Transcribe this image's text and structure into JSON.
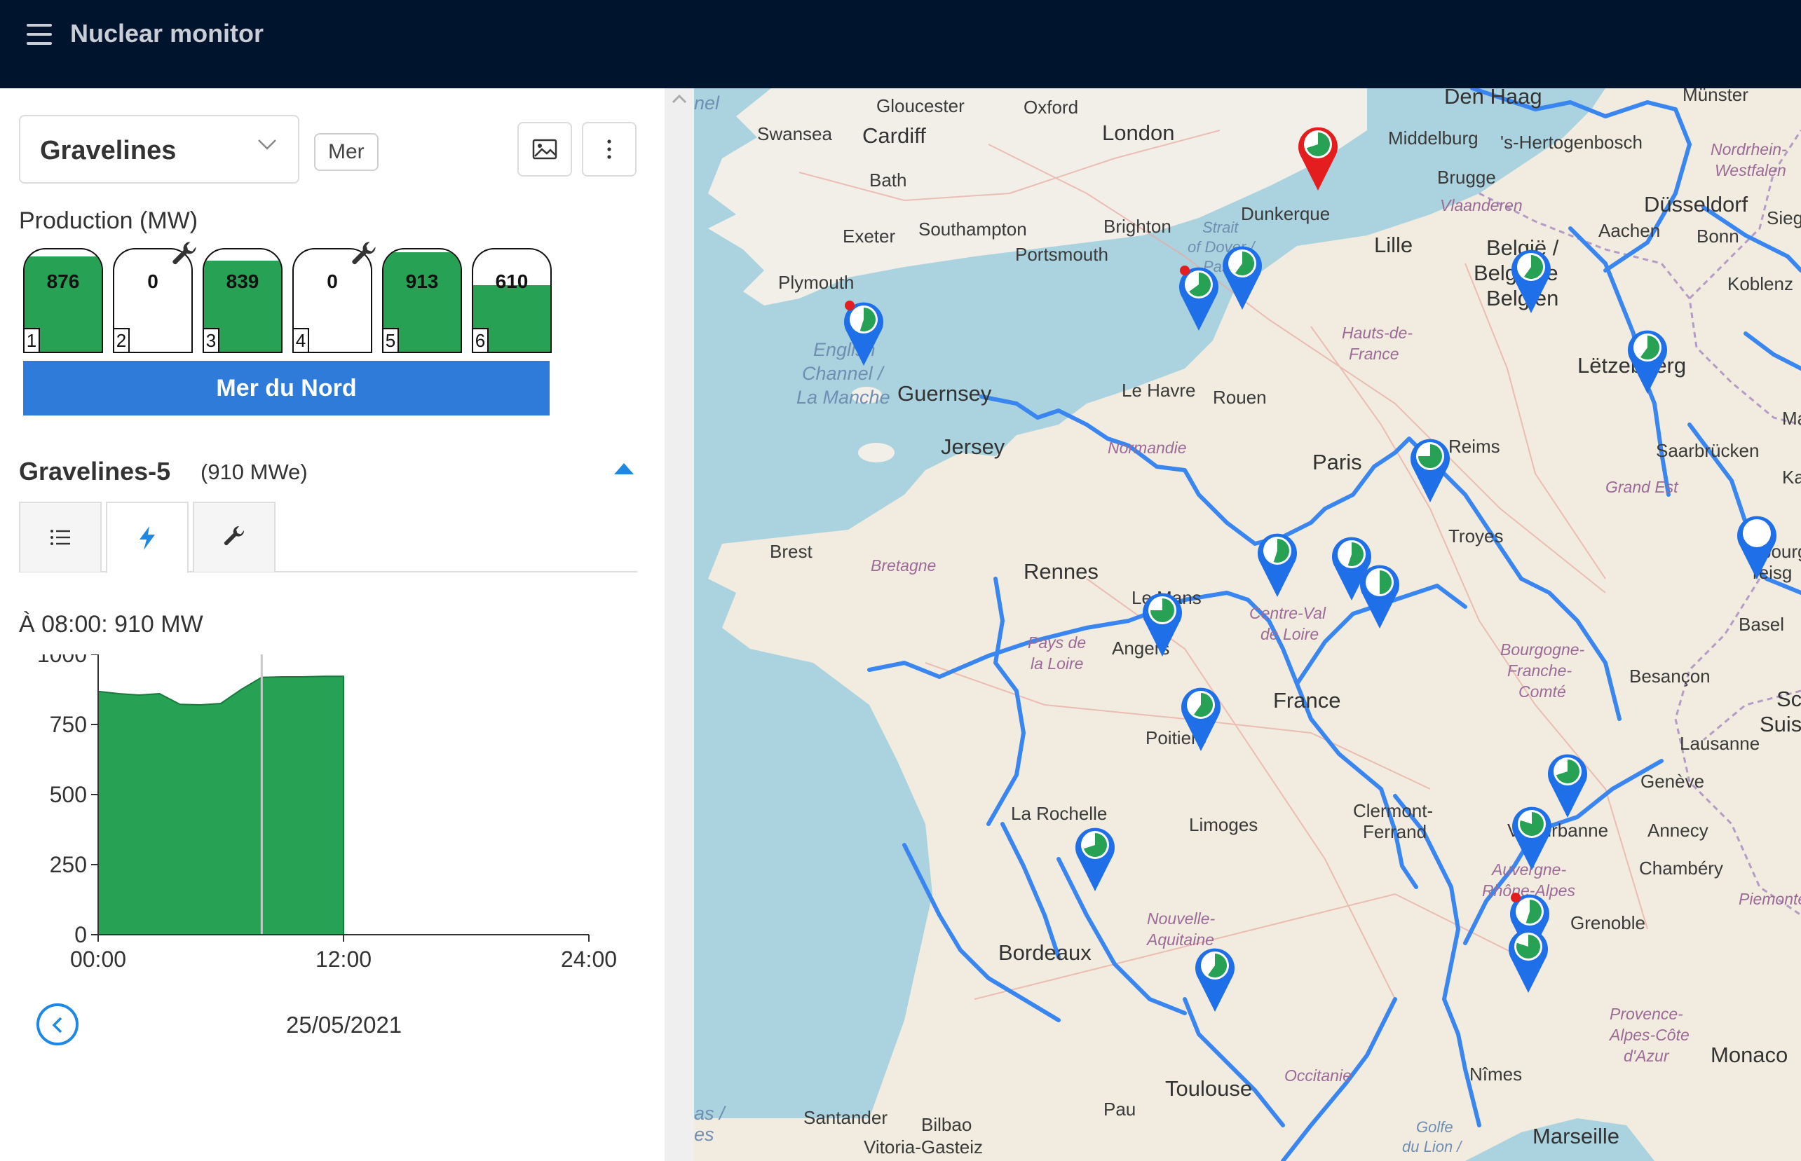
{
  "app": {
    "title": "Nuclear monitor"
  },
  "site_selector": {
    "selected": "Gravelines"
  },
  "tag": "Mer",
  "production": {
    "label": "Production (MW)",
    "reactors": [
      {
        "num": "1",
        "value": "876",
        "fill": 0.93,
        "maintenance": false
      },
      {
        "num": "2",
        "value": "0",
        "fill": 0,
        "maintenance": true
      },
      {
        "num": "3",
        "value": "839",
        "fill": 0.89,
        "maintenance": false
      },
      {
        "num": "4",
        "value": "0",
        "fill": 0,
        "maintenance": true
      },
      {
        "num": "5",
        "value": "913",
        "fill": 0.97,
        "maintenance": false
      },
      {
        "num": "6",
        "value": "610",
        "fill": 0.65,
        "maintenance": false
      }
    ],
    "cooling_source": "Mer du Nord"
  },
  "unit": {
    "name": "Gravelines-5",
    "capacity": "(910 MWe)"
  },
  "at_time": "À 08:00: 910 MW",
  "date": "25/05/2021",
  "chart_data": {
    "type": "area",
    "x": [
      0,
      1,
      2,
      3,
      4,
      5,
      6,
      7,
      8,
      9,
      10,
      11,
      12
    ],
    "x_units": "hours",
    "values": [
      868,
      860,
      855,
      860,
      822,
      820,
      825,
      875,
      918,
      920,
      920,
      922,
      922
    ],
    "xlim": [
      0,
      24
    ],
    "ylim": [
      0,
      1000
    ],
    "x_ticks": [
      "00:00",
      "12:00",
      "24:00"
    ],
    "y_ticks": [
      "0",
      "250",
      "500",
      "750",
      "1000"
    ],
    "cursor_x": 8,
    "color": "#27a254"
  },
  "map": {
    "labels": {
      "den_haag": "Den Haag",
      "munster": "Münster",
      "gloucester": "Gloucester",
      "oxford": "Oxford",
      "swansea": "Swansea",
      "cardiff": "Cardiff",
      "london": "London",
      "middelburg": "Middelburg",
      "hertogenbosch": "'s-Hertogenbosch",
      "nordrhein": "Nordrhein-",
      "westfalen": "Westfalen",
      "bath": "Bath",
      "brugge": "Brugge",
      "dusseldorf": "Düsseldorf",
      "siege": "Siege",
      "exeter": "Exeter",
      "southampton": "Southampton",
      "brighton": "Brighton",
      "dunkerque": "Dunkerque",
      "vlaanderen": "Vlaanderen",
      "aachen": "Aachen",
      "bonn": "Bonn",
      "portsmouth": "Portsmouth",
      "strait": "Strait",
      "dover": "of Dover /",
      "pas_de": "Pas de",
      "lille": "Lille",
      "belgie": "België /",
      "belgique": "Belgique",
      "belgien": "Belgien",
      "plymouth": "Plymouth",
      "koblenz": "Koblenz",
      "english": "English",
      "channel": "Channel /",
      "la_manche": "La Manche",
      "guernsey": "Guernsey",
      "hauts": "Hauts-de-",
      "france_region": "France",
      "letzebuerg": "Lëtzebuerg",
      "le_havre": "Le Havre",
      "rouen": "Rouen",
      "jersey": "Jersey",
      "normandie": "Normandie",
      "reims": "Reims",
      "saarbrucken": "Saarbrücken",
      "ma": "Ma",
      "paris": "Paris",
      "grand_est": "Grand Est",
      "ka": "Ka",
      "brest": "Brest",
      "troyes": "Troyes",
      "bretagne": "Bretagne",
      "rennes": "Rennes",
      "le_mans": "Le Mans",
      "centre": "Centre-Val",
      "de_loire": "de Loire",
      "pays": "Pays de",
      "la_loire": "la Loire",
      "angers": "Angers",
      "bourgogne": "Bourgogne-",
      "franche": "Franche-",
      "comte": "Comté",
      "besancon": "Besançon",
      "basel": "Basel",
      "france": "France",
      "poitiers": "Poitiers",
      "sc": "Sc",
      "suisse": "Suisse",
      "lausanne": "Lausanne",
      "geneve": "Genève",
      "la_rochelle": "La Rochelle",
      "limoges": "Limoges",
      "clermont": "Clermont-",
      "ferrand": "Ferrand",
      "villeurbanne": "Villeurbanne",
      "annecy": "Annecy",
      "auvergne": "Auvergne-",
      "rhone": "Rhône-Alpes",
      "chambery": "Chambéry",
      "piemonte": "Piemonte",
      "nouvelle": "Nouvelle-",
      "aquitaine": "Aquitaine",
      "grenoble": "Grenoble",
      "bordeaux": "Bordeaux",
      "provence": "Provence-",
      "alpes": "Alpes-Côte",
      "dazur": "d'Azur",
      "monaco": "Monaco",
      "toulouse": "Toulouse",
      "occitanie": "Occitanie",
      "nimes": "Nîmes",
      "pau": "Pau",
      "santander": "Santander",
      "bilbao": "Bilbao",
      "vitoria": "Vitoria-Gasteiz",
      "golfe": "Golfe",
      "du_lion": "du Lion /",
      "marseille": "Marseille",
      "nel": "nel",
      "as": "as /",
      "es": "es",
      "ourg": "bourg",
      "reisg": "reisg"
    }
  }
}
